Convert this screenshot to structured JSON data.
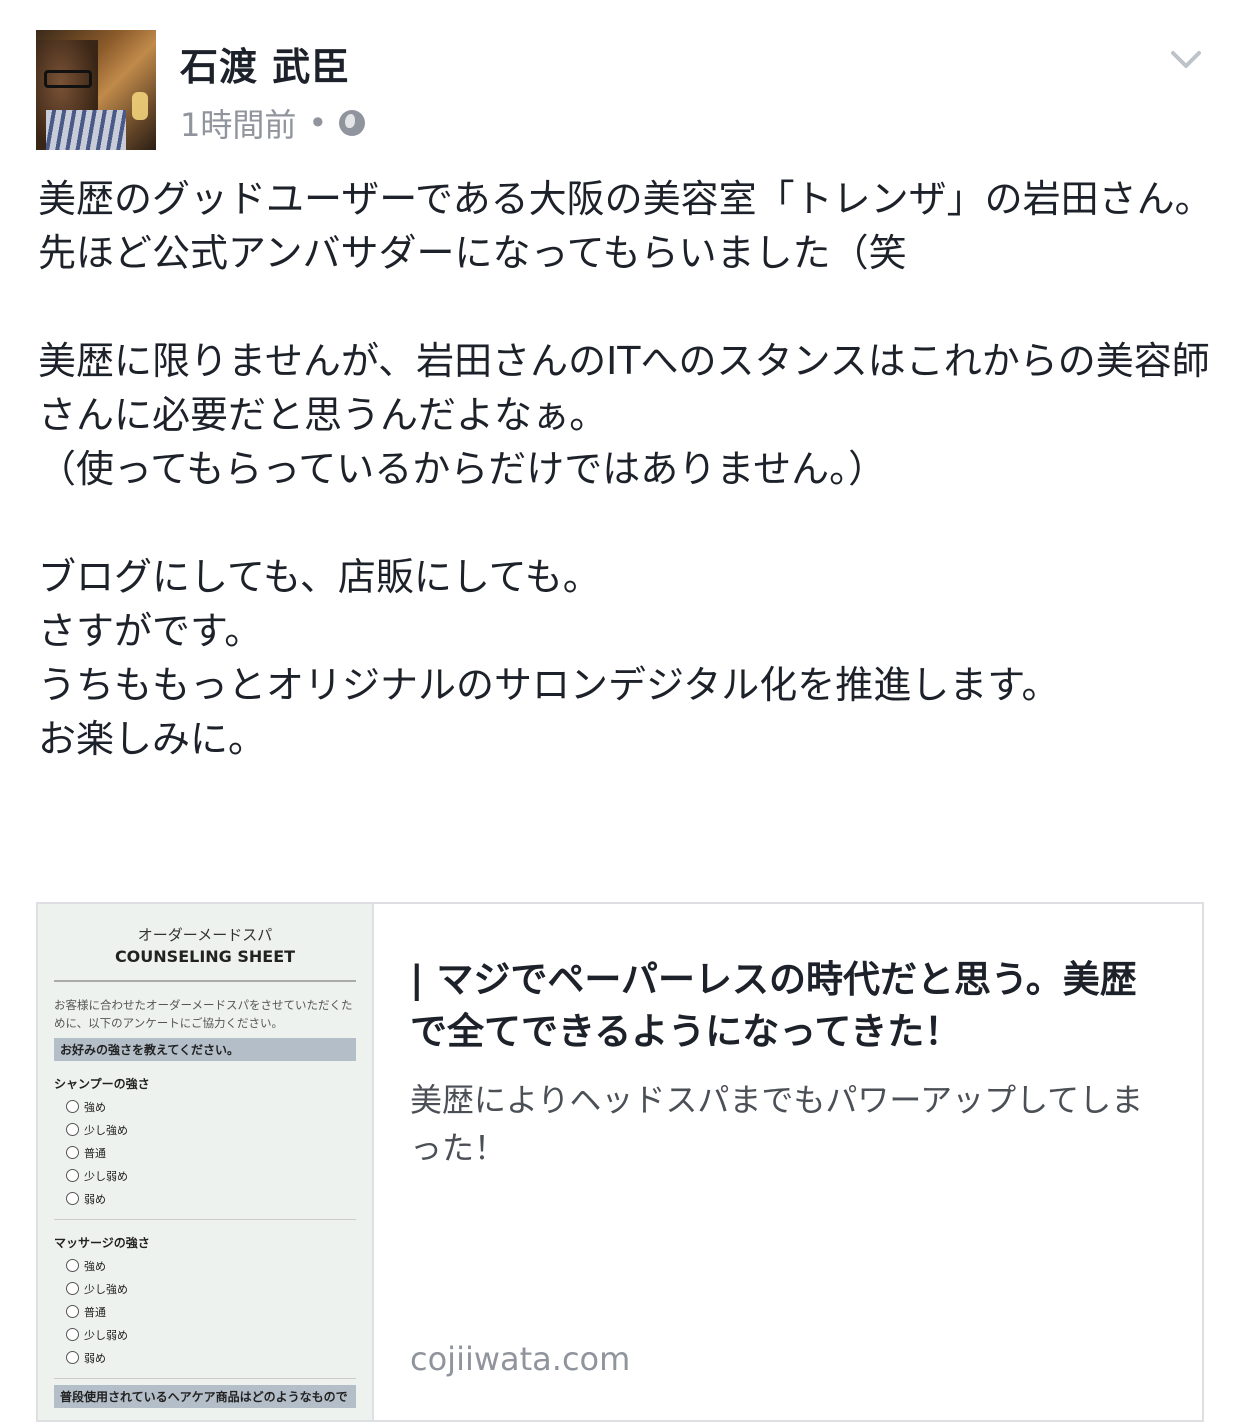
{
  "post": {
    "author": "石渡 武臣",
    "timestamp": "1時間前",
    "separator": "•",
    "privacy_icon": "globe-icon",
    "menu_icon": "chevron-down-icon",
    "lines": [
      "美歴のグッドユーザーである大阪の美容室「トレンザ」の岩田さん。",
      "先ほど公式アンバサダーになってもらいました（笑",
      "",
      "美歴に限りませんが、岩田さんのITへのスタンスはこれからの美容師さんに必要だと思うんだよなぁ。",
      "（使ってもらっているからだけではありません。）",
      "",
      "ブログにしても、店販にしても。",
      "さすがです。",
      "うちももっとオリジナルのサロンデジタル化を推進します。",
      "お楽しみに。"
    ]
  },
  "link_card": {
    "title": "| マジでペーパーレスの時代だと思う。美歴で全てできるようになってきた！",
    "description": "美歴によりヘッドスパまでもパワーアップしてしまった！",
    "domain": "cojiiwata.com",
    "thumbnail": {
      "heading": "オーダーメードスパ",
      "subheading": "COUNSELING SHEET",
      "intro": "お客様に合わせたオーダーメードスパをさせていただくために、以下のアンケートにご協力ください。",
      "section_label": "お好みの強さを教えてください。",
      "question1": "シャンプーの強さ",
      "question2": "マッサージの強さ",
      "options": [
        "強め",
        "少し強め",
        "普通",
        "少し弱め",
        "弱め"
      ],
      "bottom_label": "普段使用されているヘアケア商品はどのようなもので"
    }
  }
}
